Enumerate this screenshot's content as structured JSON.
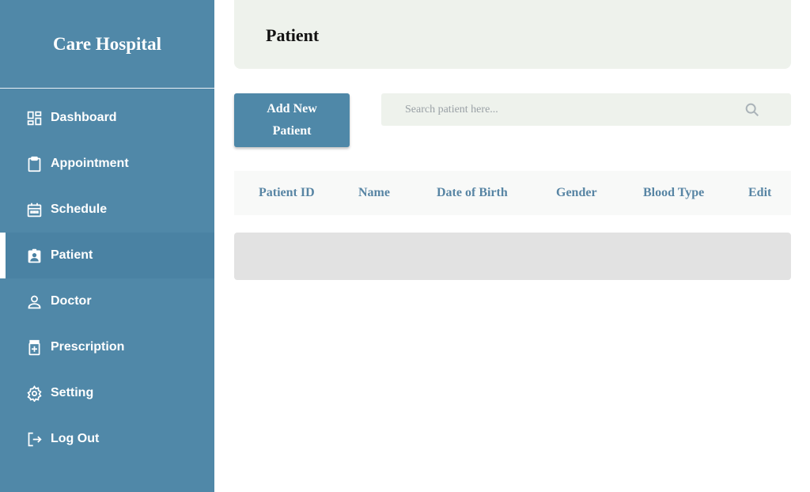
{
  "sidebar": {
    "brand": "Care Hospital",
    "items": [
      {
        "label": "Dashboard",
        "icon": "dashboard-icon",
        "active": false
      },
      {
        "label": "Appointment",
        "icon": "clipboard-icon",
        "active": false
      },
      {
        "label": "Schedule",
        "icon": "calendar-icon",
        "active": false
      },
      {
        "label": "Patient",
        "icon": "patient-badge-icon",
        "active": true
      },
      {
        "label": "Doctor",
        "icon": "person-icon",
        "active": false
      },
      {
        "label": "Prescription",
        "icon": "medicine-icon",
        "active": false
      },
      {
        "label": "Setting",
        "icon": "gear-icon",
        "active": false
      },
      {
        "label": "Log Out",
        "icon": "logout-icon",
        "active": false
      }
    ]
  },
  "header": {
    "title": "Patient"
  },
  "toolbar": {
    "add_label": "Add New Patient"
  },
  "search": {
    "placeholder": "Search patient here...",
    "value": ""
  },
  "table": {
    "columns": [
      "Patient ID",
      "Name",
      "Date of Birth",
      "Gender",
      "Blood Type",
      "Edit"
    ],
    "rows": []
  },
  "colors": {
    "sidebar": "#5088a8",
    "accent": "#4f88a8",
    "panel": "#eef2ec",
    "header_text": "#5885a4"
  }
}
